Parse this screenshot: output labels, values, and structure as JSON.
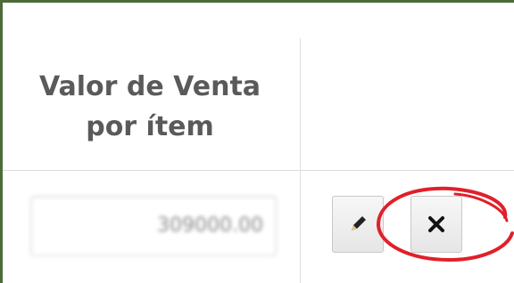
{
  "table": {
    "header": {
      "line1": "Valor de Venta",
      "line2": "por ítem"
    },
    "row": {
      "value": "309000.00"
    }
  },
  "actions": {
    "edit_icon": "pencil-icon",
    "delete_icon": "close-icon"
  },
  "colors": {
    "frame_border": "#4d6b3a",
    "highlight_circle": "#e0202a",
    "header_text": "#5a5a5a"
  }
}
